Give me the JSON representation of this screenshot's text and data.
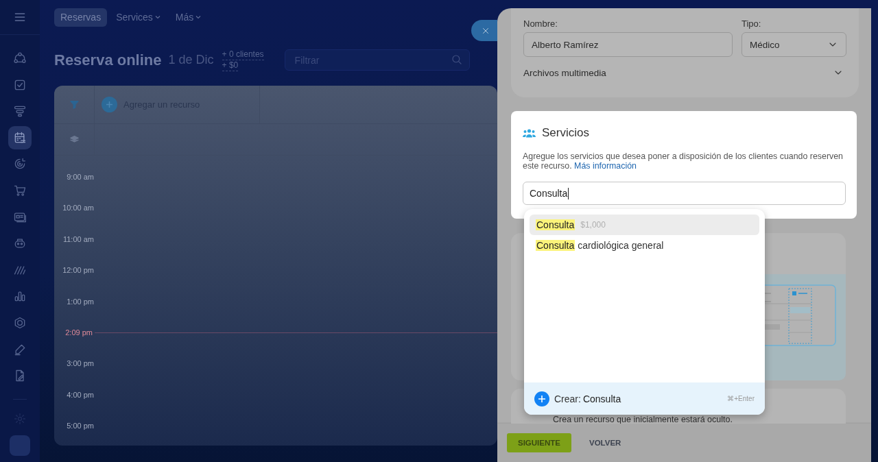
{
  "sidebar": {
    "items": [
      {
        "selected": false
      },
      {
        "selected": false
      },
      {
        "selected": false
      },
      {
        "selected": true
      },
      {
        "selected": false
      },
      {
        "selected": false
      },
      {
        "selected": false
      },
      {
        "selected": false
      },
      {
        "selected": false
      },
      {
        "selected": false
      },
      {
        "selected": false
      },
      {
        "selected": false
      },
      {
        "selected": false
      }
    ]
  },
  "topbar": {
    "tabs": [
      {
        "label": "Reservas",
        "selected": true,
        "dropdown": false
      },
      {
        "label": "Services",
        "selected": false,
        "dropdown": true
      },
      {
        "label": "Más",
        "selected": false,
        "dropdown": true
      }
    ]
  },
  "header": {
    "title": "Reserva online",
    "date": "1 de Dic",
    "stats": [
      "+ 0 clientes",
      "+ $0"
    ],
    "filter": {
      "placeholder": "Filtrar"
    }
  },
  "calendar": {
    "add_resource": "Agregar un recurso",
    "times": [
      {
        "label": "9:00 am",
        "kind": "hour"
      },
      {
        "label": "10:00 am",
        "kind": "hour"
      },
      {
        "label": "11:00 am",
        "kind": "hour"
      },
      {
        "label": "12:00 pm",
        "kind": "hour"
      },
      {
        "label": "1:00 pm",
        "kind": "hour"
      },
      {
        "label": "2:09 pm",
        "kind": "now"
      },
      {
        "label": "3:00 pm",
        "kind": "hour"
      },
      {
        "label": "4:00 pm",
        "kind": "hour"
      },
      {
        "label": "5:00 pm",
        "kind": "hour"
      }
    ]
  },
  "panel": {
    "name_label": "Nombre:",
    "name_value": "Alberto Ramírez",
    "type_label": "Tipo:",
    "type_value": "Médico",
    "media_label": "Archivos multimedia",
    "media_expanded": false,
    "services": {
      "title": "Servicios",
      "description": "Agregue los servicios que desea poner a disposición de los clientes cuando reserven este recurso.",
      "link": "Más información",
      "search_value": "Consulta"
    },
    "suggestions": [
      {
        "match": "Consulta",
        "price": "$1,000",
        "selected": true
      },
      {
        "match": "Consulta",
        "rest": "cardiológica general",
        "selected": false
      }
    ],
    "create": {
      "label": "Crear:",
      "value": "Consulta",
      "shortcut": "⌘+Enter"
    },
    "hidden_note": "Crea un recurso que inicialmente estará oculto.",
    "buttons": [
      {
        "label": "SIGUIENTE",
        "kind": "primary"
      },
      {
        "label": "VOLVER",
        "kind": "link"
      }
    ]
  }
}
